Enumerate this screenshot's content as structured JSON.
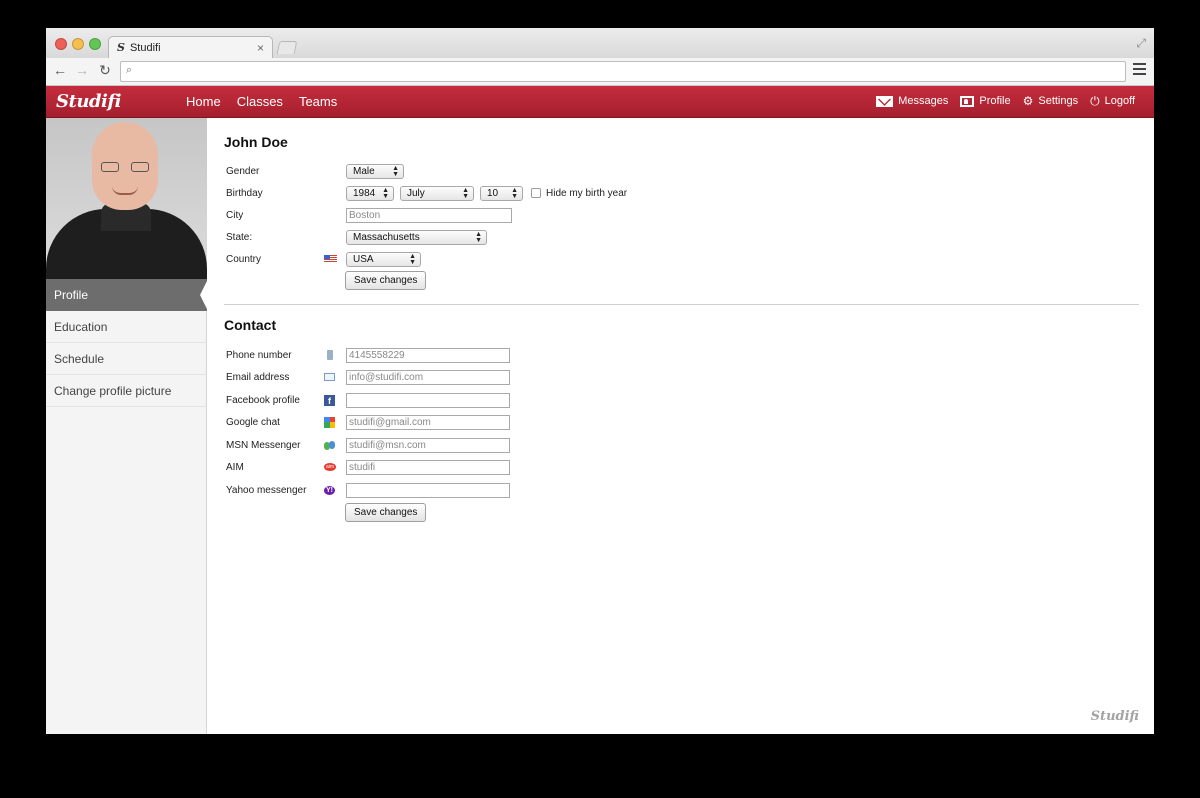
{
  "browser": {
    "tab_title": "Studifi",
    "tab_favicon": "S",
    "tab_close": "×",
    "url": ""
  },
  "app": {
    "logo": "Studifi",
    "nav": [
      "Home",
      "Classes",
      "Teams"
    ],
    "user_nav": [
      {
        "label": "Messages",
        "icon": "envelope-icon"
      },
      {
        "label": "Profile",
        "icon": "profile-card-icon"
      },
      {
        "label": "Settings",
        "icon": "gear-icon"
      },
      {
        "label": "Logoff",
        "icon": "power-icon"
      }
    ],
    "brand_color": "#b92535",
    "footer_logo": "Studifi"
  },
  "sidebar": {
    "items": [
      {
        "label": "Profile",
        "active": true
      },
      {
        "label": "Education"
      },
      {
        "label": "Schedule"
      },
      {
        "label": "Change profile picture"
      }
    ]
  },
  "profile": {
    "title": "John Doe",
    "gender_label": "Gender",
    "gender_value": "Male",
    "birthday_label": "Birthday",
    "birth_year": "1984",
    "birth_month": "July",
    "birth_day": "10",
    "hide_birth_year_label": "Hide my birth year",
    "hide_birth_year_checked": false,
    "city_label": "City",
    "city_placeholder": "Boston",
    "state_label": "State:",
    "state_value": "Massachusetts",
    "country_label": "Country",
    "country_value": "USA",
    "save_label": "Save changes"
  },
  "contact": {
    "title": "Contact",
    "fields": [
      {
        "label": "Phone number",
        "icon": "phone-icon",
        "value": "4145558229"
      },
      {
        "label": "Email address",
        "icon": "email-icon",
        "value": "info@studifi.com"
      },
      {
        "label": "Facebook profile",
        "icon": "facebook-icon",
        "value": ""
      },
      {
        "label": "Google chat",
        "icon": "google-chat-icon",
        "value": "studifi@gmail.com"
      },
      {
        "label": "MSN Messenger",
        "icon": "msn-icon",
        "value": "studifi@msn.com"
      },
      {
        "label": "AIM",
        "icon": "aim-icon",
        "value": "studifi"
      },
      {
        "label": "Yahoo messenger",
        "icon": "yahoo-icon",
        "value": ""
      }
    ],
    "save_label": "Save changes"
  }
}
